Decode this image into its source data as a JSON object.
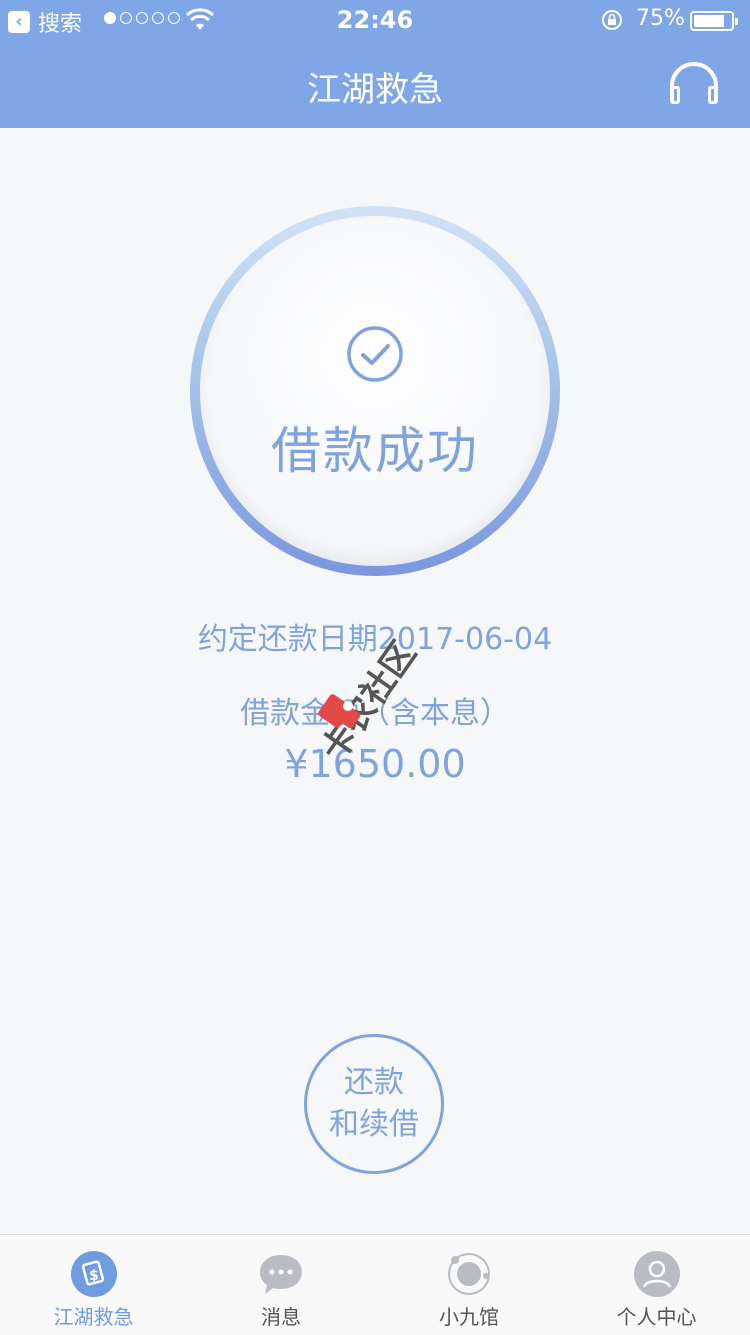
{
  "status_bar": {
    "back_app_label": "搜索",
    "time": "22:46",
    "battery_percent": "75%",
    "battery_level": 0.75,
    "signal_bars_filled": 1,
    "signal_bars_total": 5
  },
  "nav": {
    "title": "江湖救急",
    "headset_icon": "headset-icon"
  },
  "result": {
    "status_text": "借款成功",
    "status_icon": "check-circle-icon",
    "due_date_text": "约定还款日期2017-06-04",
    "amount_label": "借款金额（含本息）",
    "amount": "¥1650.00"
  },
  "actions": {
    "repay_line1": "还款",
    "repay_line2": "和续借"
  },
  "tabbar": {
    "tabs": [
      {
        "label": "江湖救急",
        "icon": "loan-icon",
        "active": true
      },
      {
        "label": "消息",
        "icon": "message-icon",
        "active": false
      },
      {
        "label": "小九馆",
        "icon": "planet-icon",
        "active": false
      },
      {
        "label": "个人中心",
        "icon": "user-icon",
        "active": false
      }
    ]
  },
  "colors": {
    "nav_bg": "#7fa6e6",
    "accent": "#7ea3dd",
    "page_bg": "#f6f7f9"
  },
  "watermark_text": "卡农社区"
}
